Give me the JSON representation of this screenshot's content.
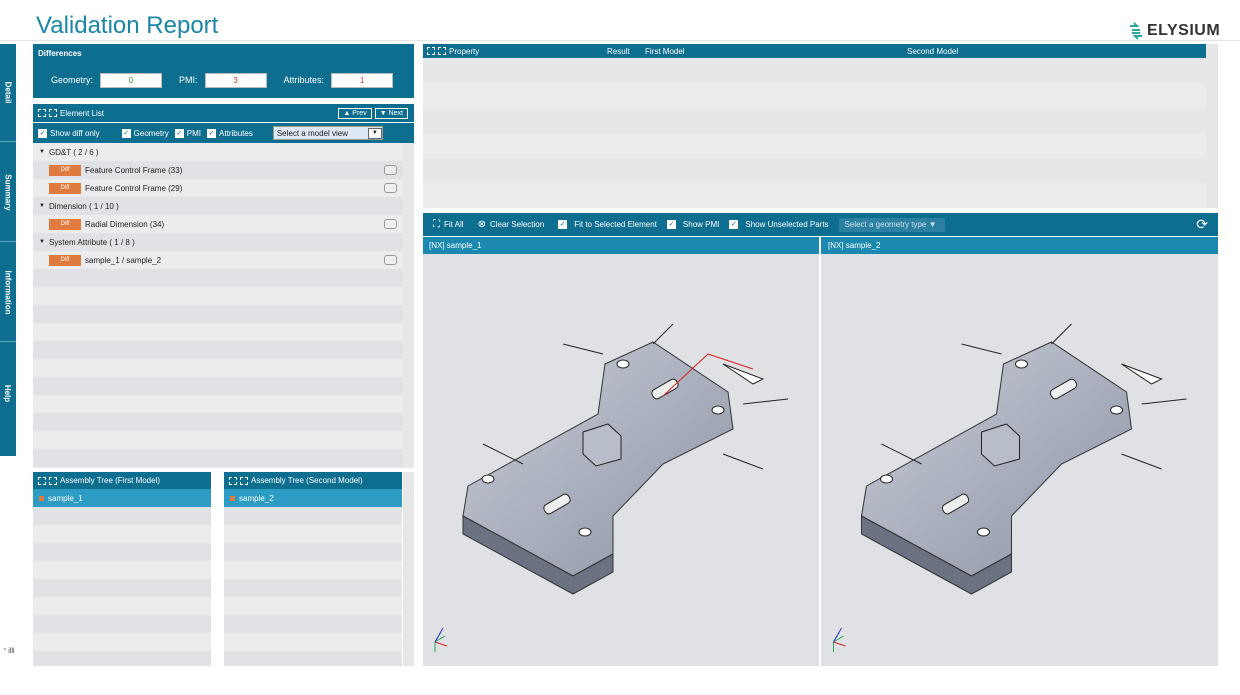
{
  "app": {
    "title": "Validation Report",
    "logo_text": "ELYSIUM"
  },
  "side_tabs": [
    "Detail",
    "Summary",
    "Information",
    "Help"
  ],
  "differences": {
    "header": "Differences",
    "geometry_label": "Geometry:",
    "geometry_value": "0",
    "pmi_label": "PMI:",
    "pmi_value": "3",
    "attributes_label": "Attributes:",
    "attributes_value": "1"
  },
  "element_list": {
    "header": "Element List",
    "prev": "▲ Prev",
    "next": "▼ Next",
    "show_diff_only": "Show diff only",
    "geometry": "Geometry",
    "pmi": "PMI",
    "attributes": "Attributes",
    "model_view_placeholder": "Select a model view",
    "groups": [
      {
        "label": "GD&T ( 2 / 6 )",
        "items": [
          {
            "badge": "Diff",
            "label": "Feature Control Frame (33)"
          },
          {
            "badge": "Diff",
            "label": "Feature Control Frame (29)"
          }
        ]
      },
      {
        "label": "Dimension ( 1 / 10 )",
        "items": [
          {
            "badge": "Diff",
            "label": "Radial Dimension (34)"
          }
        ]
      },
      {
        "label": "System Attribute ( 1 / 8 )",
        "items": [
          {
            "badge": "Diff",
            "label": "sample_1 / sample_2"
          }
        ]
      }
    ]
  },
  "assembly": {
    "first_header": "Assembly Tree (First Model)",
    "second_header": "Assembly Tree (Second Model)",
    "first_item": "sample_1",
    "second_item": "sample_2"
  },
  "property_table": {
    "col_property": "Property",
    "col_result": "Result",
    "col_first": "First Model",
    "col_second": "Second Model"
  },
  "viewer_toolbar": {
    "fit_all": "Fit All",
    "clear_selection": "Clear Selection",
    "fit_selected": "Fit to Selected Element",
    "show_pmi": "Show PMI",
    "show_unselected": "Show Unselected Parts",
    "geometry_type": "Select a geometry type ▼"
  },
  "viewports": [
    {
      "label": "[NX] sample_1"
    },
    {
      "label": "[NX] sample_2"
    }
  ],
  "corner_glyph": "° illl",
  "colors": {
    "accent": "#0e6e8f",
    "title": "#1a86a8",
    "diff_badge": "#e07a3f",
    "selected_row": "#2d9cc4",
    "diff_value_red": "#c0392b",
    "diff_value_green": "#2a8a4a"
  }
}
